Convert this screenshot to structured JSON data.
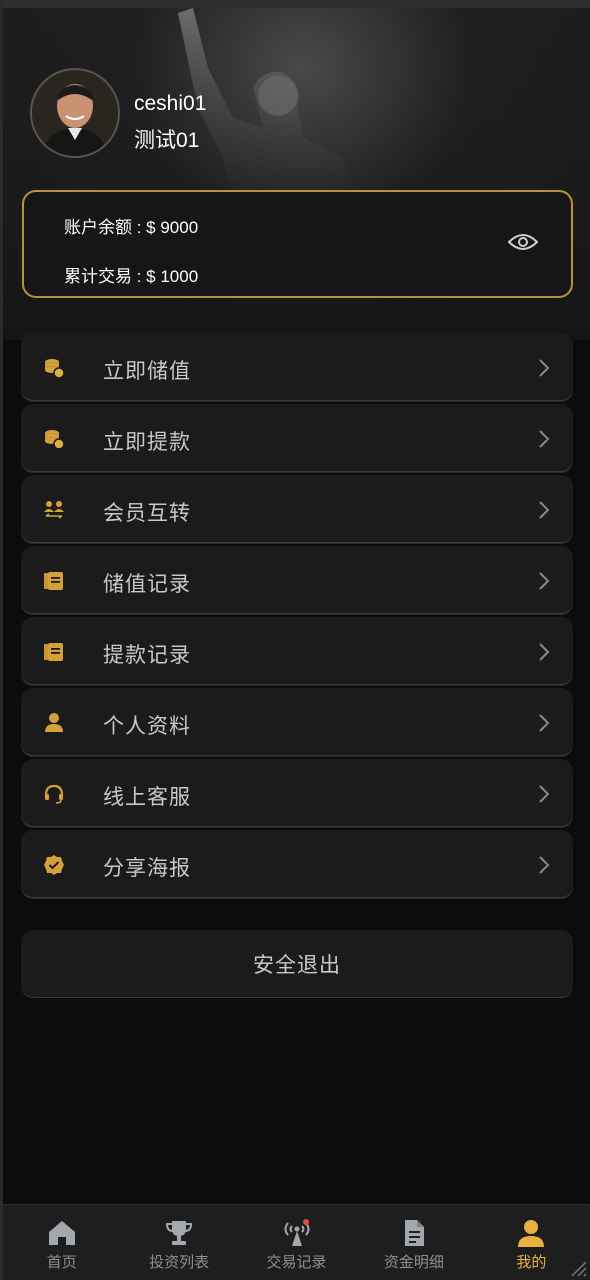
{
  "profile": {
    "username": "ceshi01",
    "nickname": "测试01"
  },
  "balance": {
    "balance_label": "账户余额 : $ 9000",
    "total_label": "累计交易 : $ 1000",
    "toggle_icon": "eye-icon"
  },
  "menu": {
    "items": [
      {
        "label": "立即储值",
        "icon": "coins-icon"
      },
      {
        "label": "立即提款",
        "icon": "coins-icon"
      },
      {
        "label": "会员互转",
        "icon": "transfer-users-icon"
      },
      {
        "label": "储值记录",
        "icon": "ledger-icon"
      },
      {
        "label": "提款记录",
        "icon": "ledger-icon"
      },
      {
        "label": "个人资料",
        "icon": "user-icon"
      },
      {
        "label": "线上客服",
        "icon": "headset-icon"
      },
      {
        "label": "分享海报",
        "icon": "badge-check-icon"
      }
    ]
  },
  "logout": {
    "label": "安全退出"
  },
  "tabbar": {
    "tabs": [
      {
        "label": "首页",
        "icon": "home-icon"
      },
      {
        "label": "投资列表",
        "icon": "trophy-icon"
      },
      {
        "label": "交易记录",
        "icon": "broadcast-icon"
      },
      {
        "label": "资金明细",
        "icon": "document-icon"
      },
      {
        "label": "我的",
        "icon": "user-icon"
      }
    ],
    "active_index": 4
  },
  "colors": {
    "accent": "#e7b23f",
    "card_border": "#b8923a",
    "background": "#0c0c0c",
    "menu_item_bg": "#1b1b1b"
  }
}
